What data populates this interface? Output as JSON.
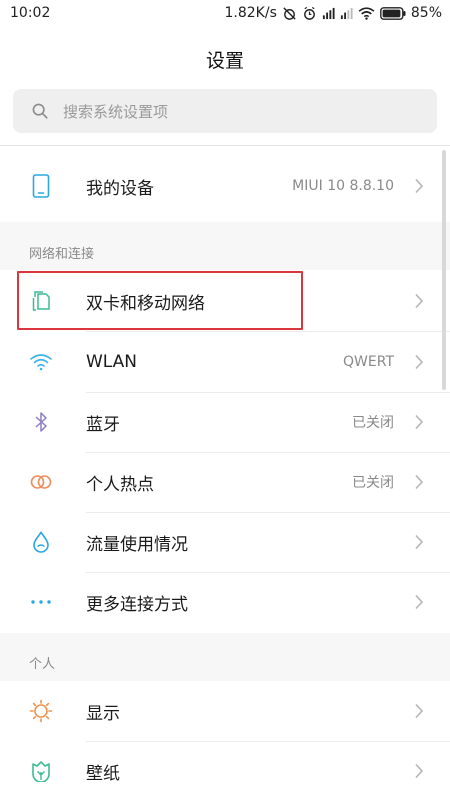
{
  "status_bar": {
    "time": "10:02",
    "speed": "1.82K/s",
    "battery": "85%"
  },
  "header": {
    "title": "设置"
  },
  "search": {
    "placeholder": "搜索系统设置项"
  },
  "device": {
    "label": "我的设备",
    "value": "MIUI 10 8.8.10"
  },
  "sections": {
    "network": {
      "title": "网络和连接"
    },
    "personal": {
      "title": "个人"
    }
  },
  "network_items": [
    {
      "label": "双卡和移动网络",
      "value": ""
    },
    {
      "label": "WLAN",
      "value": "QWERT"
    },
    {
      "label": "蓝牙",
      "value": "已关闭"
    },
    {
      "label": "个人热点",
      "value": "已关闭"
    },
    {
      "label": "流量使用情况",
      "value": ""
    },
    {
      "label": "更多连接方式",
      "value": ""
    }
  ],
  "personal_items": [
    {
      "label": "显示",
      "value": ""
    },
    {
      "label": "壁纸",
      "value": ""
    }
  ],
  "colors": {
    "accent_blue": "#2aa8e0",
    "wifi_blue": "#3ab3f0",
    "bluetooth_purple": "#8e7cc3",
    "hotspot_orange": "#ef8d5a",
    "display_orange": "#f2924e",
    "wallpaper_green": "#3dbc94",
    "highlight_red": "#d9363e"
  }
}
